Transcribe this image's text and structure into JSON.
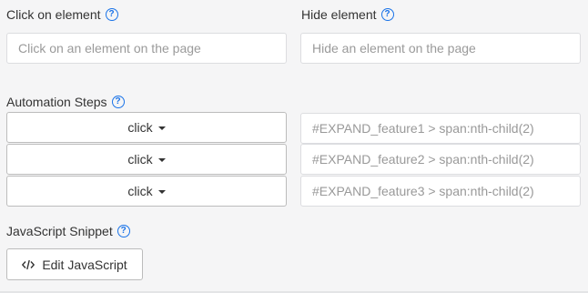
{
  "click_element": {
    "label": "Click on element",
    "placeholder": "Click on an element on the page"
  },
  "hide_element": {
    "label": "Hide element",
    "placeholder": "Hide an element on the page"
  },
  "automation": {
    "label": "Automation Steps",
    "steps": [
      {
        "action": "click",
        "selector": "#EXPAND_feature1 > span:nth-child(2)"
      },
      {
        "action": "click",
        "selector": "#EXPAND_feature2 > span:nth-child(2)"
      },
      {
        "action": "click",
        "selector": "#EXPAND_feature3 > span:nth-child(2)"
      }
    ]
  },
  "javascript": {
    "label": "JavaScript Snippet",
    "button_label": "Edit JavaScript"
  },
  "help_glyph": "?",
  "colors": {
    "accent": "#1a73e8",
    "background": "#f5f5f6",
    "input_border": "#dcdde0",
    "button_border": "#bcbcbc"
  },
  "icons": [
    "help-icon",
    "caret-down-icon",
    "code-icon"
  ]
}
